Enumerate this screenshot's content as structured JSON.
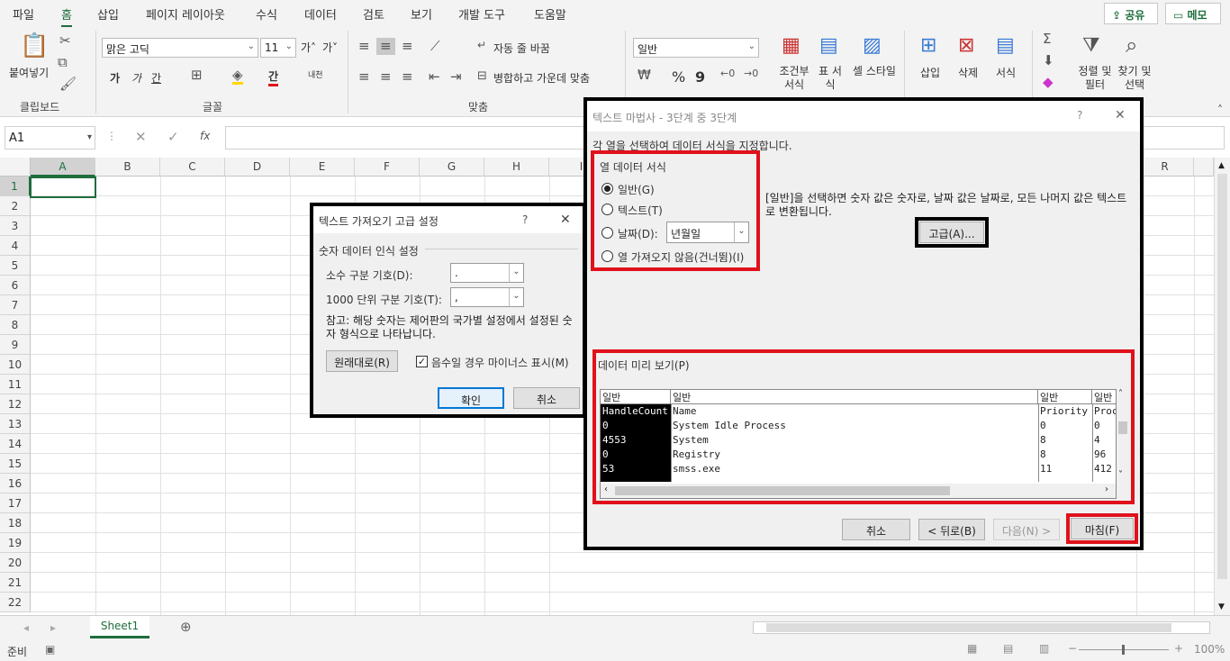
{
  "menu": {
    "items": [
      "파일",
      "홈",
      "삽입",
      "페이지 레이아웃",
      "수식",
      "데이터",
      "검토",
      "보기",
      "개발 도구",
      "도움말"
    ],
    "share": "공유",
    "memo": "메모"
  },
  "ribbon": {
    "clipboard": {
      "paste": "붙여넣기",
      "group": "클립보드"
    },
    "font": {
      "name": "맑은 고딕",
      "size": "11",
      "grow": "가˄",
      "shrink": "가˅",
      "bold": "가",
      "italic": "가",
      "underline": "간",
      "phonetic": "내천",
      "group": "글꼴"
    },
    "align": {
      "wrap": "자동 줄 바꿈",
      "merge": "병합하고 가운데 맞춤",
      "group": "맞춤"
    },
    "number": {
      "format": "일반",
      "percent": "%",
      "comma": "9"
    },
    "styles": {
      "conditional": "조건부 서식",
      "table": "표 서식",
      "cell": "셀 스타일"
    },
    "cells": {
      "insert": "삽입",
      "delete": "삭제",
      "format": "서식"
    },
    "editing": {
      "sort": "정렬 및 필터",
      "find": "찾기 및 선택"
    }
  },
  "formula": {
    "namebox": "A1",
    "fx": "fx"
  },
  "grid": {
    "columns": [
      "A",
      "B",
      "C",
      "D",
      "E",
      "F",
      "G",
      "H",
      "I",
      "R"
    ],
    "rows": [
      "1",
      "2",
      "3",
      "4",
      "5",
      "6",
      "7",
      "8",
      "9",
      "10",
      "11",
      "12",
      "13",
      "14",
      "15",
      "16",
      "17",
      "18",
      "19",
      "20",
      "21",
      "22"
    ]
  },
  "sheet": {
    "tab": "Sheet1",
    "status": "준비",
    "zoom": "100%"
  },
  "wizard": {
    "title": "텍스트 마법사 - 3단계 중 3단계",
    "help": "?",
    "close": "✕",
    "instruction": "각 열을 선택하여 데이터 서식을 지정합니다.",
    "format_group": "열 데이터 서식",
    "opt_general": "일반(G)",
    "opt_text": "텍스트(T)",
    "opt_date": "날짜(D):",
    "date_value": "년월일",
    "opt_skip": "열 가져오지 않음(건너뜀)(I)",
    "desc": "[일반]을 선택하면 숫자 값은 숫자로, 날짜 값은 날짜로, 모든 나머지 값은 텍스트로 변환됩니다.",
    "advanced": "고급(A)...",
    "preview_label": "데이터 미리 보기(P)",
    "preview_headers": [
      "일반",
      "일반",
      "일반",
      "일반"
    ],
    "preview_rows": [
      [
        "HandleCount",
        "Name",
        "Priority",
        "Proc"
      ],
      [
        "0",
        "System Idle Process",
        "0",
        "0"
      ],
      [
        "4553",
        "System",
        "8",
        "4"
      ],
      [
        "0",
        "Registry",
        "8",
        "96"
      ],
      [
        "53",
        "smss.exe",
        "11",
        "412"
      ]
    ],
    "cancel": "취소",
    "back": "< 뒤로(B)",
    "next": "다음(N) >",
    "finish": "마침(F)"
  },
  "advanced_dialog": {
    "title": "텍스트 가져오기 고급 설정",
    "help": "?",
    "close": "✕",
    "section": "숫자 데이터 인식 설정",
    "decimal_label": "소수 구분 기호(D):",
    "decimal_value": ".",
    "thousands_label": "1000 단위 구분 기호(T):",
    "thousands_value": ",",
    "note": "참고: 해당 숫자는 제어판의 국가별 설정에서 설정된 숫자 형식으로 나타납니다.",
    "reset": "원래대로(R)",
    "trailing_minus": "음수일 경우 마이너스 표시(M)",
    "ok": "확인",
    "cancel": "취소"
  }
}
